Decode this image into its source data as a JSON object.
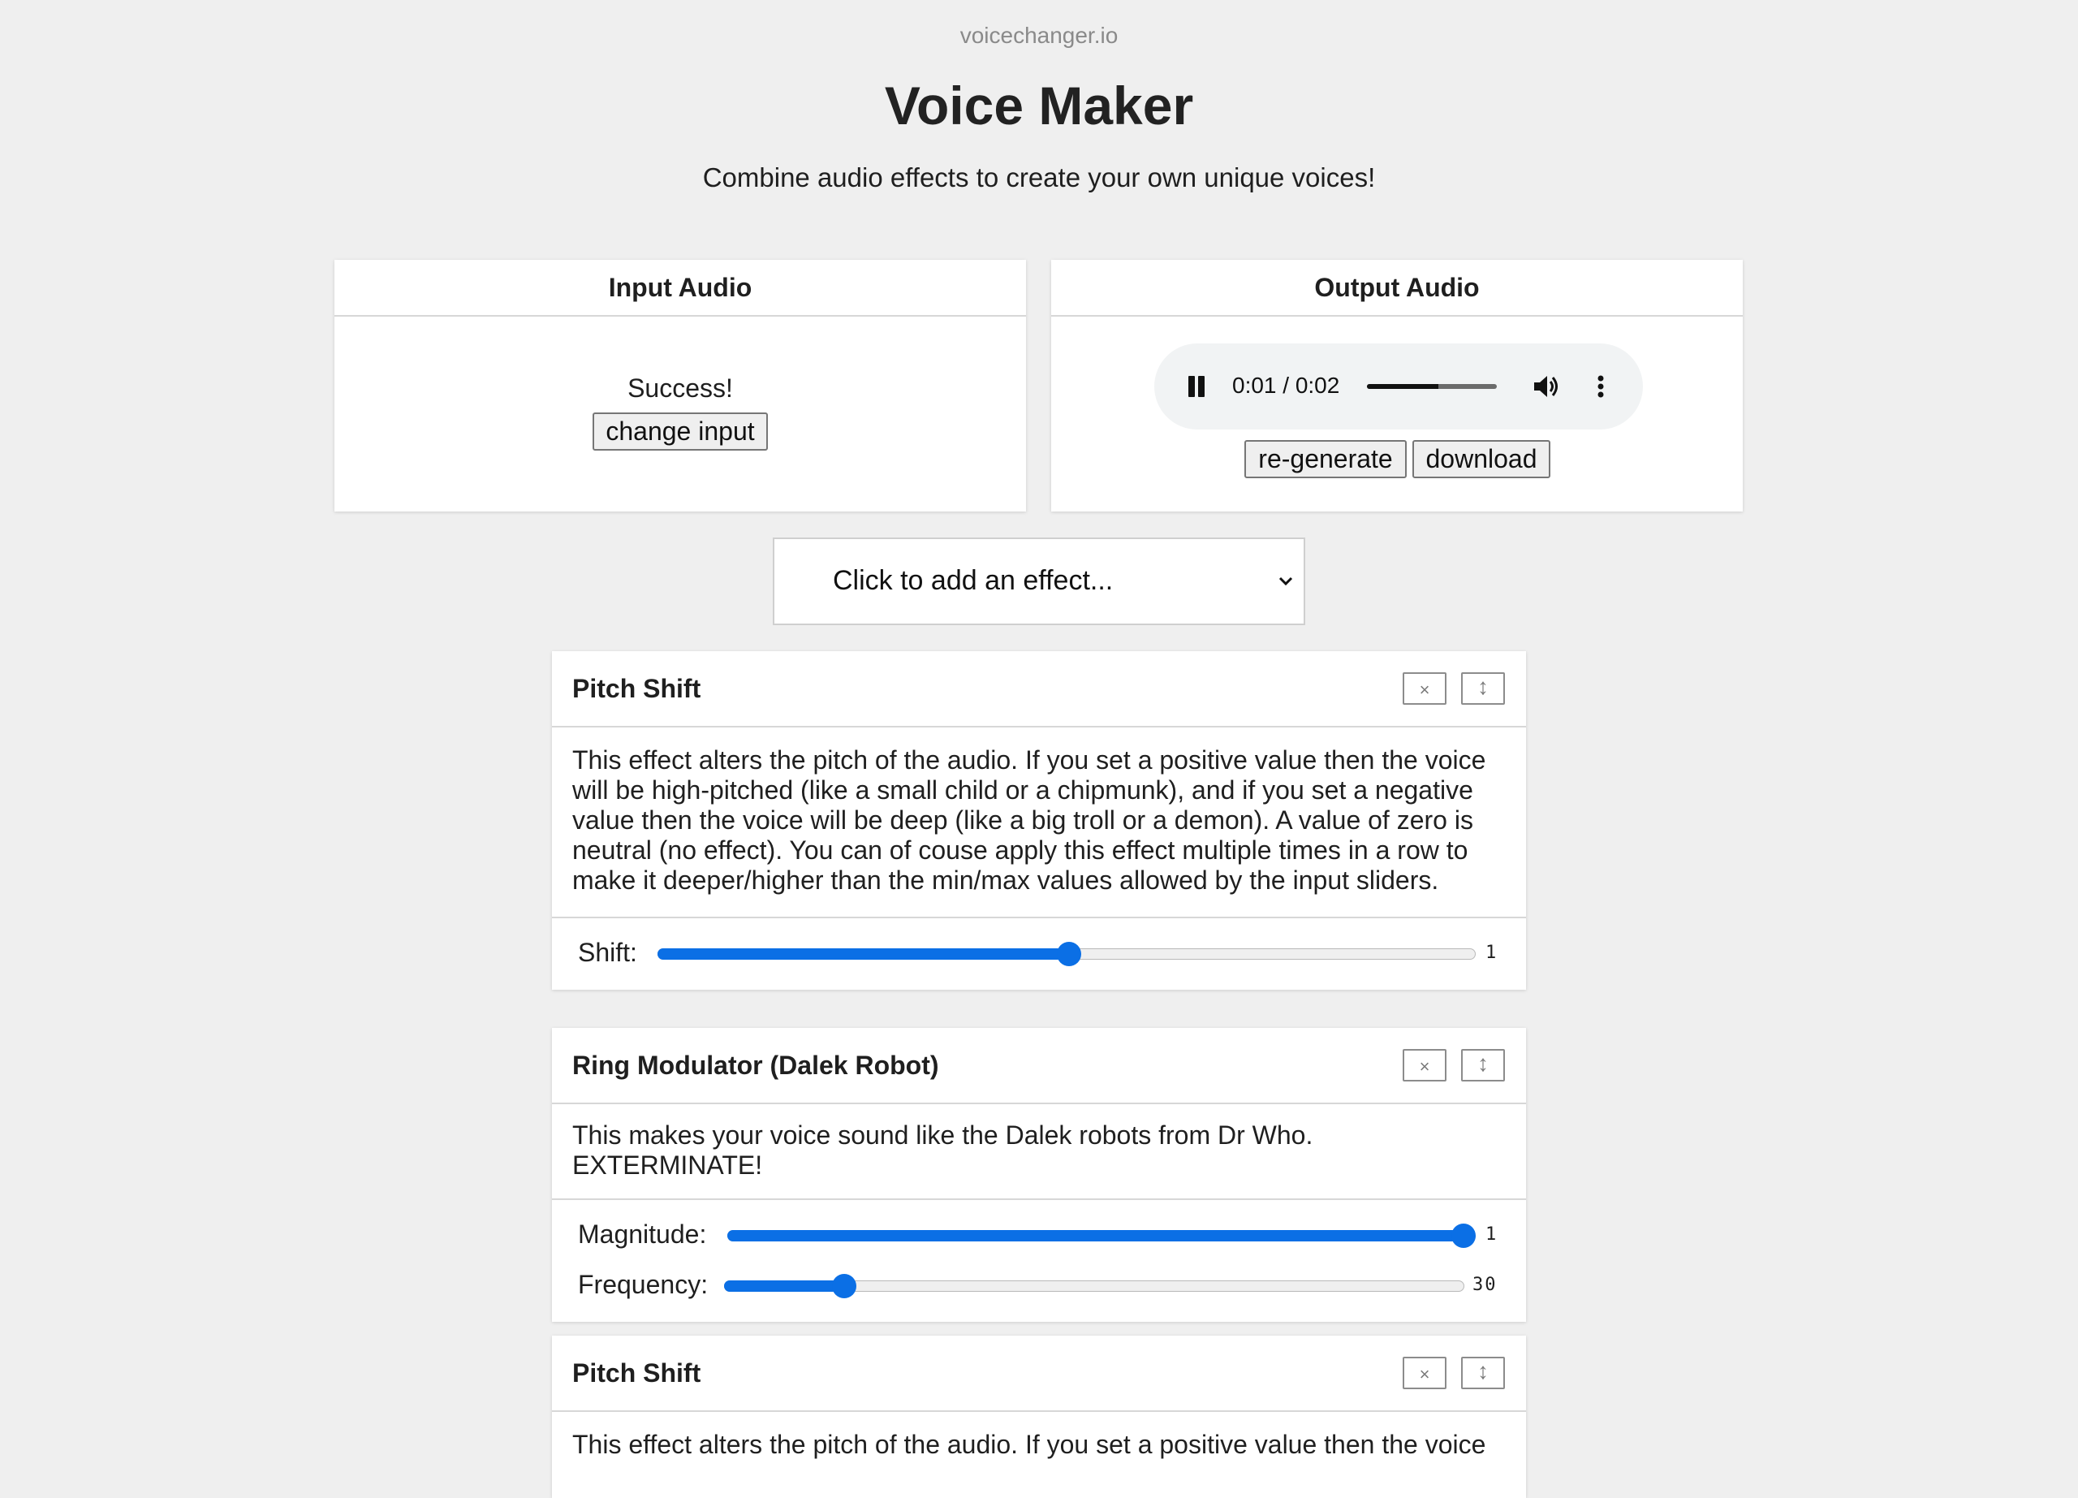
{
  "header": {
    "site_name": "voicechanger.io",
    "title": "Voice Maker",
    "subtitle": "Combine audio effects to create your own unique voices!"
  },
  "input_panel": {
    "title": "Input Audio",
    "status": "Success!",
    "change_button": "change input"
  },
  "output_panel": {
    "title": "Output Audio",
    "player": {
      "time": "0:01 / 0:02",
      "progress_fraction": 0.55,
      "pause_icon": "pause-icon",
      "volume_icon": "volume-icon",
      "more_icon": "more-options-icon"
    },
    "regenerate_button": "re-generate",
    "download_button": "download"
  },
  "effect_select": {
    "selected": "Click to add an effect..."
  },
  "effects": [
    {
      "title": "Pitch Shift",
      "close_label": "×",
      "move_label": "↕",
      "description": "This effect alters the pitch of the audio. If you set a positive value then the voice will be high-pitched (like a small child or a chipmunk), and if you set a negative value then the voice will be deep (like a big troll or a demon). A value of zero is neutral (no effect). You can of couse apply this effect multiple times in a row to make it deeper/higher than the min/max values allowed by the input sliders.",
      "controls": [
        {
          "label": "Shift:",
          "value": "1",
          "fraction": 0.503
        }
      ]
    },
    {
      "title": "Ring Modulator (Dalek Robot)",
      "close_label": "×",
      "move_label": "↕",
      "description": "This makes your voice sound like the Dalek robots from Dr Who. EXTERMINATE!",
      "controls": [
        {
          "label": "Magnitude:",
          "value": "1",
          "fraction": 1.0
        },
        {
          "label": "Frequency:",
          "value": "30",
          "fraction": 0.161
        }
      ]
    },
    {
      "title": "Pitch Shift",
      "close_label": "×",
      "move_label": "↕",
      "description": "This effect alters the pitch of the audio. If you set a positive value then the voice"
    }
  ],
  "colors": {
    "background": "#efefef",
    "accent": "#0b6fe5",
    "card": "#ffffff"
  }
}
